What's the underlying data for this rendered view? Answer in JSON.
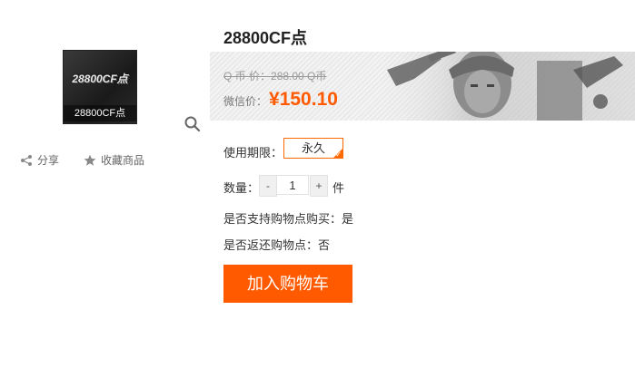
{
  "product": {
    "title": "28800CF点",
    "thumbnail_logo_text": "28800CF点",
    "thumbnail_caption": "28800CF点"
  },
  "actions": {
    "share_label": "分享",
    "favorite_label": "收藏商品"
  },
  "price": {
    "original_label": "Q 币 价：",
    "original_value": "288.00 Q币",
    "wechat_label": "微信价：",
    "wechat_value": "¥150.10"
  },
  "period": {
    "label": "使用期限：",
    "selected_option": "永久"
  },
  "quantity": {
    "label": "数量：",
    "minus": "-",
    "plus": "+",
    "value": "1",
    "unit": "件"
  },
  "info": {
    "support_points": "是否支持购物点购买：是",
    "rebate_points": "是否返还购物点：否"
  },
  "cart_button_label": "加入购物车",
  "colors": {
    "accent": "#ff5a00",
    "border_accent": "#ff6a00"
  }
}
